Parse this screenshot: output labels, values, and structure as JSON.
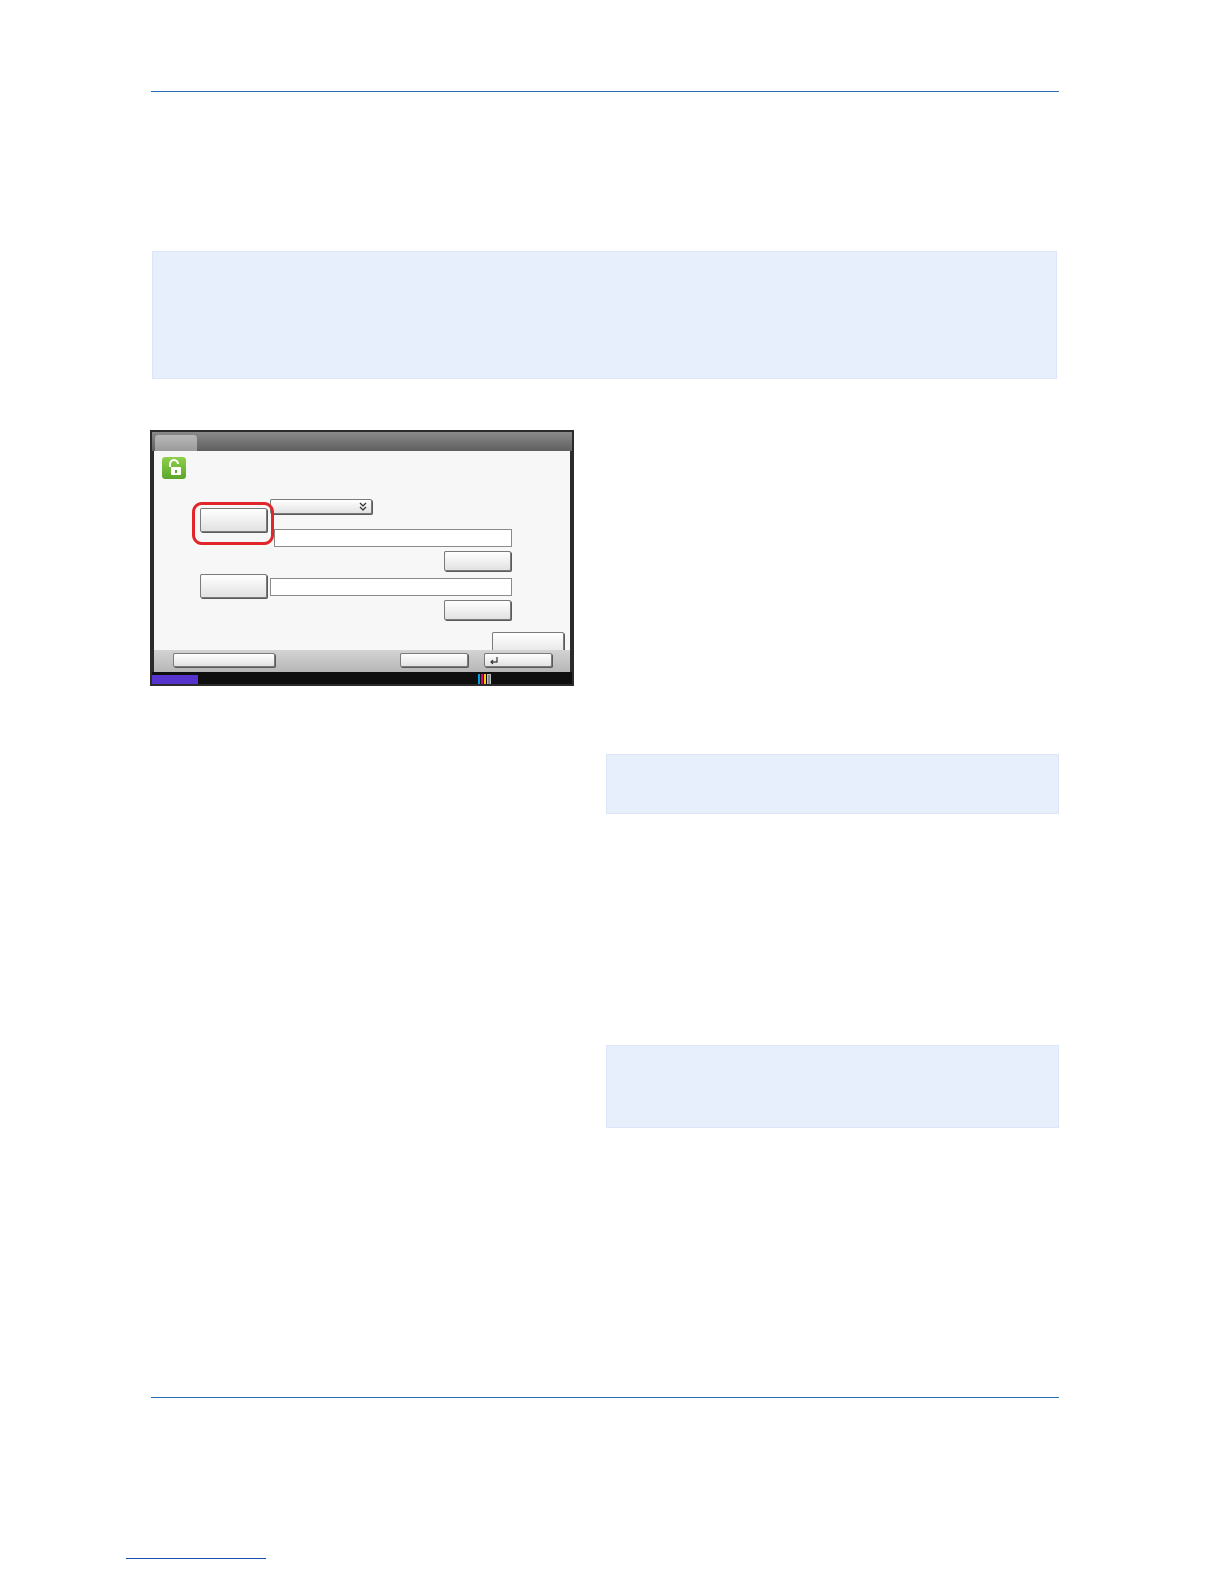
{
  "page": {
    "accent_color": "#2a6fb5",
    "note_color": "#e7eefc"
  },
  "device_screen": {
    "status_bar_color": "#5533cc",
    "highlight_color": "#e0262b",
    "icons": [
      "unlock-icon",
      "double-chevron-down-icon",
      "enter-icon",
      "toner-level-icon"
    ],
    "toner_colors": [
      "#00a0e0",
      "#e0007a",
      "#f0d000",
      "#111111"
    ]
  }
}
